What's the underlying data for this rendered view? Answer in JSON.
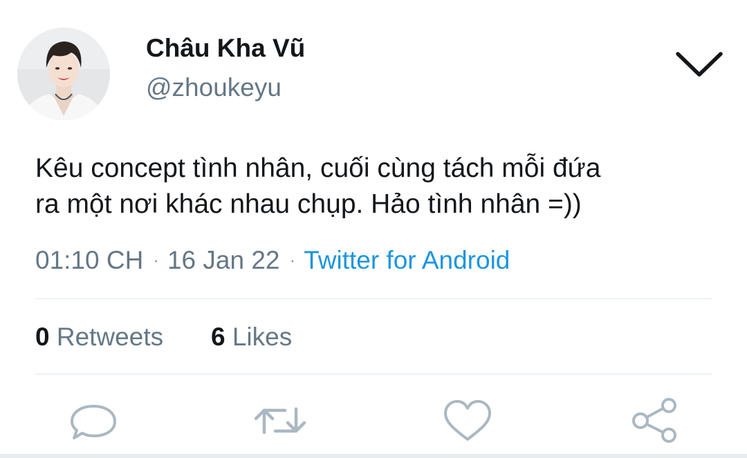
{
  "user": {
    "display_name": "Châu Kha Vũ",
    "handle": "@zhoukeyu"
  },
  "tweet": {
    "text_lines": [
      "Kêu concept tình nhân, cuối cùng tách mỗi đứa",
      "ra một nơi khác nhau chụp. Hảo tình nhân =))"
    ],
    "time": "01:10 CH",
    "separator": "·",
    "date": "16 Jan 22",
    "source": "Twitter for Android"
  },
  "stats": {
    "retweets_count": "0",
    "retweets_label": "Retweets",
    "likes_count": "6",
    "likes_label": "Likes"
  },
  "actions": {
    "icons": [
      "reply-icon",
      "retweet-icon",
      "like-icon",
      "share-icon"
    ]
  },
  "colors": {
    "text": "#14171a",
    "secondary": "#657786",
    "link": "#1b95e0",
    "icon": "#aab8c2",
    "divider": "#e1e8ed"
  }
}
